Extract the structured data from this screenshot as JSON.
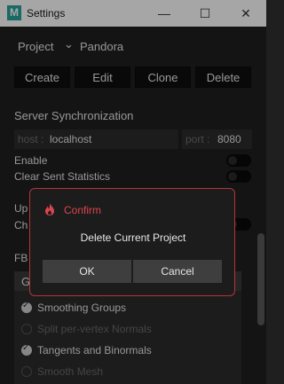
{
  "window": {
    "title": "Settings",
    "app_icon_letter": "M",
    "controls": {
      "minimize": "—",
      "maximize": "☐",
      "close": "✕"
    }
  },
  "project": {
    "label": "Project",
    "chevron": "⌄",
    "name": "Pandora"
  },
  "toolbar": {
    "create": "Create",
    "edit": "Edit",
    "clone": "Clone",
    "delete": "Delete"
  },
  "server": {
    "title": "Server Synchronization",
    "host_label": "host :",
    "host_value": "localhost",
    "port_label": "port :",
    "port_value": "8080",
    "enable_label": "Enable",
    "enable_on": false,
    "clear_label": "Clear Sent Statistics",
    "clear_on": false
  },
  "partial": {
    "up_label": "Up",
    "ch_label": "Ch",
    "fb_label": "FB",
    "g_label": "G"
  },
  "options": [
    {
      "label": "Smoothing Groups",
      "checked": true
    },
    {
      "label": "Split per-vertex Normals",
      "checked": false
    },
    {
      "label": "Tangents and Binormals",
      "checked": true
    },
    {
      "label": "Smooth Mesh",
      "checked": false
    }
  ],
  "dialog": {
    "title": "Confirm",
    "message": "Delete Current Project",
    "ok": "OK",
    "cancel": "Cancel"
  },
  "colors": {
    "accent": "#d9464d",
    "background": "#1f1f1f"
  }
}
